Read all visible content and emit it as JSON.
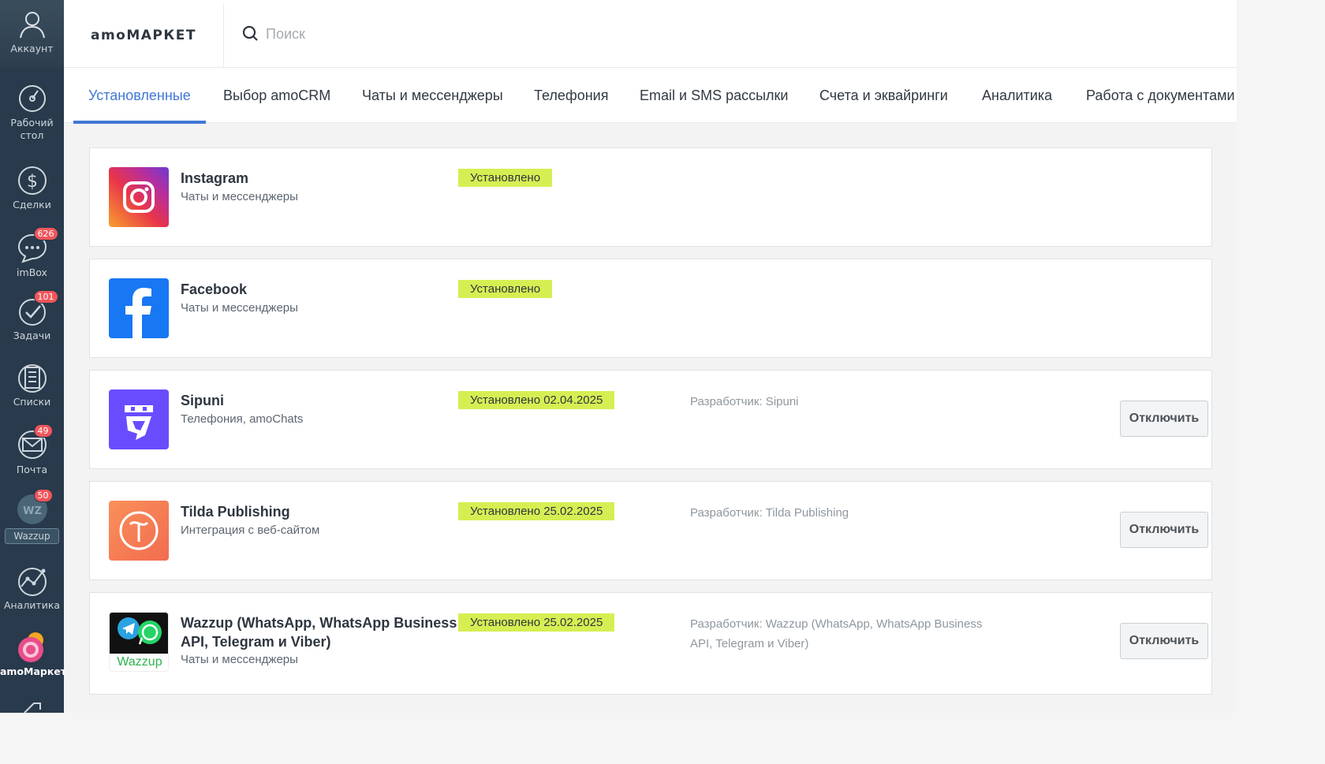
{
  "sidebar": {
    "items": [
      {
        "label": "Аккаунт",
        "icon": "account-icon"
      },
      {
        "label": "Рабочий стол",
        "icon": "dashboard-icon"
      },
      {
        "label": "Сделки",
        "icon": "deals-icon"
      },
      {
        "label": "imBox",
        "icon": "chat-icon",
        "badge": "626"
      },
      {
        "label": "Задачи",
        "icon": "tasks-icon",
        "badge": "101"
      },
      {
        "label": "Списки",
        "icon": "lists-icon"
      },
      {
        "label": "Почта",
        "icon": "mail-icon",
        "badge": "49"
      },
      {
        "label": "Wazzup",
        "icon": "wazzup-icon",
        "badge": "50",
        "icon_text": "WZ"
      },
      {
        "label": "Аналитика",
        "icon": "analytics-icon"
      },
      {
        "label": "amoМаркет",
        "icon": "amomarket-icon",
        "active": true
      }
    ]
  },
  "header": {
    "brand": "amoМАРКЕТ",
    "search_placeholder": "Поиск"
  },
  "tabs": [
    {
      "label": "Установленные",
      "active": true
    },
    {
      "label": "Выбор amoCRM"
    },
    {
      "label": "Чаты и мессенджеры"
    },
    {
      "label": "Телефония"
    },
    {
      "label": "Email и SMS рассылки"
    },
    {
      "label": "Счета и эквайринги"
    },
    {
      "label": "Аналитика"
    },
    {
      "label": "Работа с документами"
    }
  ],
  "apps": [
    {
      "name": "Instagram",
      "category": "Чаты и мессенджеры",
      "status": "Установлено",
      "icon": "instagram-icon"
    },
    {
      "name": "Facebook",
      "category": "Чаты и мессенджеры",
      "status": "Установлено",
      "icon": "facebook-icon"
    },
    {
      "name": "Sipuni",
      "category": "Телефония, amoChats",
      "status": "Установлено 02.04.2025",
      "developer": "Разработчик: Sipuni",
      "button": "Отключить",
      "icon": "sipuni-icon"
    },
    {
      "name": "Tilda Publishing",
      "category": "Интеграция с веб-сайтом",
      "status": "Установлено 25.02.2025",
      "developer": "Разработчик: Tilda Publishing",
      "button": "Отключить",
      "icon": "tilda-icon"
    },
    {
      "name_line1": "Wazzup (WhatsApp, WhatsApp Business",
      "name_line2": "API, Telegram и Viber)",
      "category": "Чаты и мессенджеры",
      "status": "Установлено 25.02.2025",
      "developer_line1": "Разработчик: Wazzup (WhatsApp, WhatsApp Business",
      "developer_line2": "API, Telegram и Viber)",
      "button": "Отключить",
      "icon": "wazzup-app-icon",
      "logo_text": "Wazzup"
    }
  ],
  "colors": {
    "sidebar_bg": "#283a4b",
    "accent": "#4077d6",
    "status_bg": "#d7ee53",
    "badge_bg": "#f2565b"
  }
}
